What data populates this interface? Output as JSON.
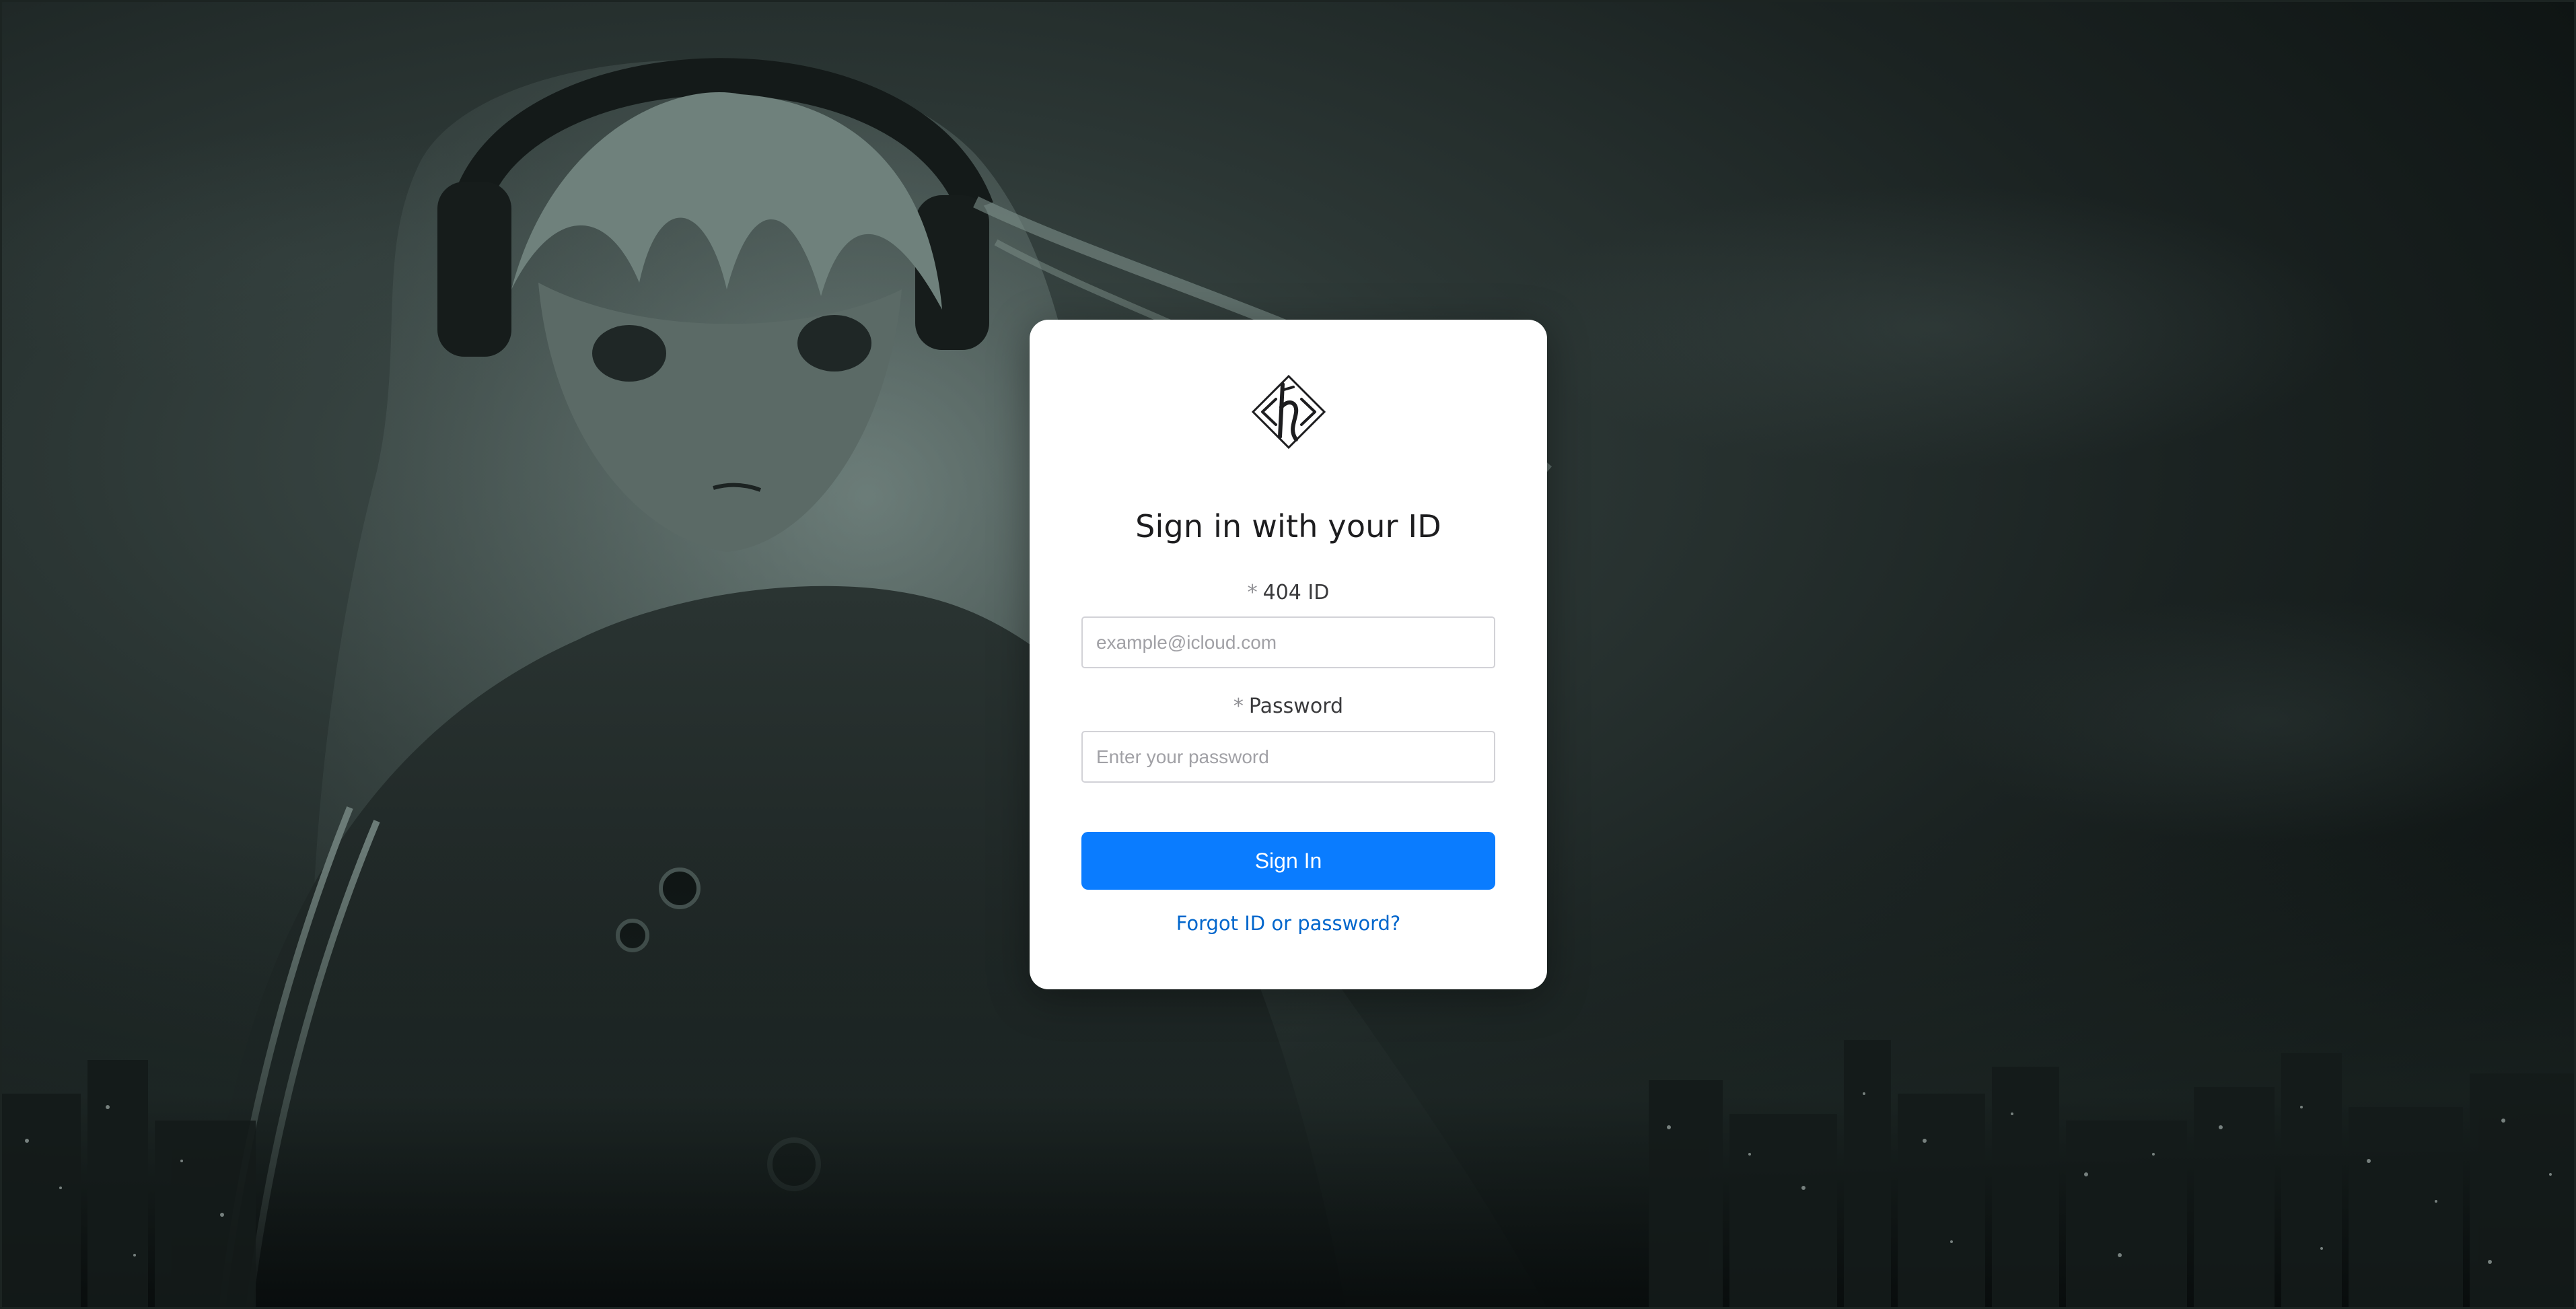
{
  "login": {
    "title": "Sign in with your ID",
    "id_field": {
      "required_mark": "*",
      "label": "404 ID",
      "placeholder": "example@icloud.com",
      "value": ""
    },
    "password_field": {
      "required_mark": "*",
      "label": "Password",
      "placeholder": "Enter your password",
      "value": ""
    },
    "submit_label": "Sign In",
    "forgot_link": "Forgot ID or password?"
  },
  "icons": {
    "logo": "brand-logo-icon"
  },
  "colors": {
    "primary": "#0a7cff",
    "link": "#0066cc",
    "card": "#ffffff",
    "background": "#1b2322"
  }
}
